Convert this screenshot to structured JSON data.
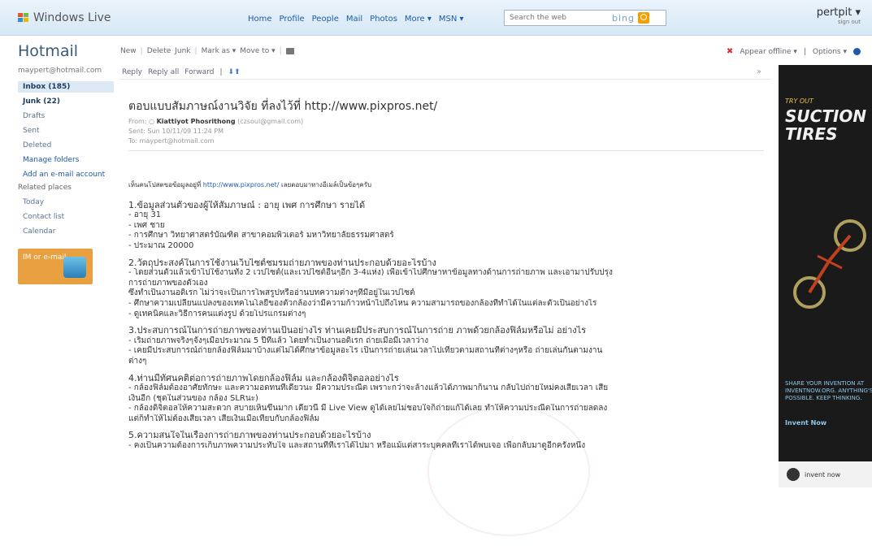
{
  "topbar": {
    "logo": "Windows Live",
    "nav": [
      "Home",
      "Profile",
      "People",
      "Mail",
      "Photos",
      "More ▾",
      "MSN ▾"
    ],
    "search_placeholder": "Search the web",
    "search_brand": "bing",
    "user_name": "pertpit ▾",
    "sign_out": "sign out"
  },
  "toolbar": {
    "app_title": "Hotmail",
    "actions": [
      "New",
      "Delete",
      "Junk",
      "Mark as ▾",
      "Move to ▾"
    ],
    "appear_offline": "Appear offline ▾",
    "options": "Options ▾"
  },
  "sidebar": {
    "account_email": "maypert@hotmail.com",
    "folders": [
      {
        "label": "Inbox (185)",
        "state": "selected"
      },
      {
        "label": "Junk (22)",
        "state": "bold"
      },
      {
        "label": "Drafts",
        "state": "normal"
      },
      {
        "label": "Sent",
        "state": "normal"
      },
      {
        "label": "Deleted",
        "state": "normal"
      }
    ],
    "manage_folders": "Manage folders",
    "add_account": "Add an e-mail account",
    "related_title": "Related places",
    "related": [
      "Today",
      "Contact list",
      "Calendar"
    ],
    "im_promo": "IM or e-mail"
  },
  "reading_pane": {
    "reply": "Reply",
    "reply_all": "Reply all",
    "forward": "Forward",
    "subject": "ตอบแบบสัมภาษณ์งานวิจัย ที่ลงไว้ที่ http://www.pixpros.net/",
    "from_label": "From:",
    "from_name": "Kiattiyot Phosrithong",
    "from_email": "(czsoul@gmail.com)",
    "sent_label": "Sent:",
    "sent": "Sun 10/11/09 11:24 PM",
    "to_label": "To:",
    "to": "maypert@hotmail.com",
    "intro_pre": "เห็นคนโปสตขอข้อมูลอยู่ที่",
    "intro_link": "http://www.pixpros.net/",
    "intro_post": "เลยตอบมาทางอีเมล์เป็นข้อๆครับ",
    "body": [
      {
        "text": "1.ข้อมูลส่วนตัวของผู้ให้สัมภาษณ์ : อายุ เพศ การศึกษา รายได้",
        "q": true
      },
      {
        "text": "- อายุ 31"
      },
      {
        "text": "- เพศ ชาย"
      },
      {
        "text": "- การศึกษา วิทยาศาสตร์บัณฑิต สาขาคอมพิวเตอร์ มหาวิทยาลัยธรรมศาสตร์"
      },
      {
        "text": "- ประมาณ 20000"
      },
      {
        "text": "2.วัตถุประสงค์ในการใช้งานเว็บไซต์ชมรมถ่ายภาพของท่านประกอบด้วยอะไรบ้าง",
        "q": true
      },
      {
        "text": "- โดยส่วนตัวแล้วเข้าไปใช้งานทั้ง 2 เวปไซต์(และเวปไซต์อื่นๆอีก 3-4แห่ง) เพื่อเข้าไปศึกษาหาข้อมูลทางด้านการถ่ายภาพ และเอามาปรับปรุง"
      },
      {
        "text": "การถ่ายภาพของตัวเอง"
      },
      {
        "text": "   ซึ่งทำเป็นงานอดิเรก  ไม่ว่าจะเป็นการโพสรูปหรืออ่านบทความต่างๆที่มีอยู่ในเวปไซต์"
      },
      {
        "text": "- ศึกษาความเปลี่ยนแปลงของเทคโนโลยีของตัวกล้องว่ามีความก้าวหน้าไปถึงไหน ความสามารถของกล้องที่ทำได้ในแต่ละตัวเป็นอย่างไร"
      },
      {
        "text": "- ดูเทคนิคและวิธีการคนแต่งรูป ด้วยโปรแกรมต่างๆ"
      },
      {
        "text": "3.ประสบการณ์ในการถ่ายภาพของท่านเป็นอย่างไร ท่านเคยมีประสบการณ์ในการถ่าย ภาพด้วยกล้องฟิล์มหรือไม่ อย่างไร",
        "q": true
      },
      {
        "text": "- เริ่มถ่ายภาพจริงๆจังๆเมื่อประมาณ 5 ปีที่แล้ว โดยทำเป็นงานอดิเรก ถ่ายเมื่อมีเวลาว่าง"
      },
      {
        "text": "- เคยมีประสบการณ์ถ่ายกล้องฟิล์มมาบ้างแต่ไม่ได้ศึกษาข้อมูลอะไร เป็นการถ่ายเล่นเวลาไปเที่ยวตามสถานที่ต่างๆหรือ ถ่ายเล่นกันตามงาน"
      },
      {
        "text": "ต่างๆ"
      },
      {
        "text": "4.ท่านมีทัศนคติต่อการถ่ายภาพโดยกล้องฟิล์ม และกล้องดิจิตอลอย่างไร",
        "q": true
      },
      {
        "text": "- กล้องฟิล์มต้องอาศัยทักษะ และความอดทนที่เดียวนะ มีความประณีต เพราะกว่าจะล้างแล้วได้ภาพมาก็นาน กลับไปถ่ายใหม่คงเสียเวลา เสีย"
      },
      {
        "text": "เงินอีก (ชุดในส่วนของ กล้อง SLRนะ)"
      },
      {
        "text": "- กล้องดิจิตอลให้ความสะดวก สบายเห็นขึ้นมาก เดี๋ยวนี้ มี Live View ดูได้เลยไม่ชอบใจก็ถ่ายแก้ได้เลย ทำให้ความประณีตในการถ่ายลดลง"
      },
      {
        "text": "แต่ก็ทำให้ไม่ต้องเสียเวลา เสียเงินเมื่อเทียบกับกล้องฟิล์ม"
      },
      {
        "text": "5.ความสนใจในเรื่องการถ่ายภาพของท่านประกอบด้วยอะไรบ้าง",
        "q": true
      },
      {
        "text": "- คงเป็นความต้องการเก็บภาพความประทับใจ และสถานที่ที่เราได้ไปมา หรือแม้แต่สาระบุคคลที่เราได้พบเจอ เพื่อกลับมาดูอีกครั้งหนึ่ง"
      }
    ]
  },
  "ad": {
    "kicker": "TRY OUT",
    "title": "SUCTION TIRES",
    "text": "SHARE YOUR INVENTION AT INVENTNOW.ORG. ANYTHING'S POSSIBLE. KEEP THINKING.",
    "cta": "Invent Now",
    "footer": "invent now"
  },
  "colors": {
    "accent": "#1e5aa8",
    "selected_folder_bg": "#dce9f5",
    "topbar_bg": "#d6e8f6"
  }
}
